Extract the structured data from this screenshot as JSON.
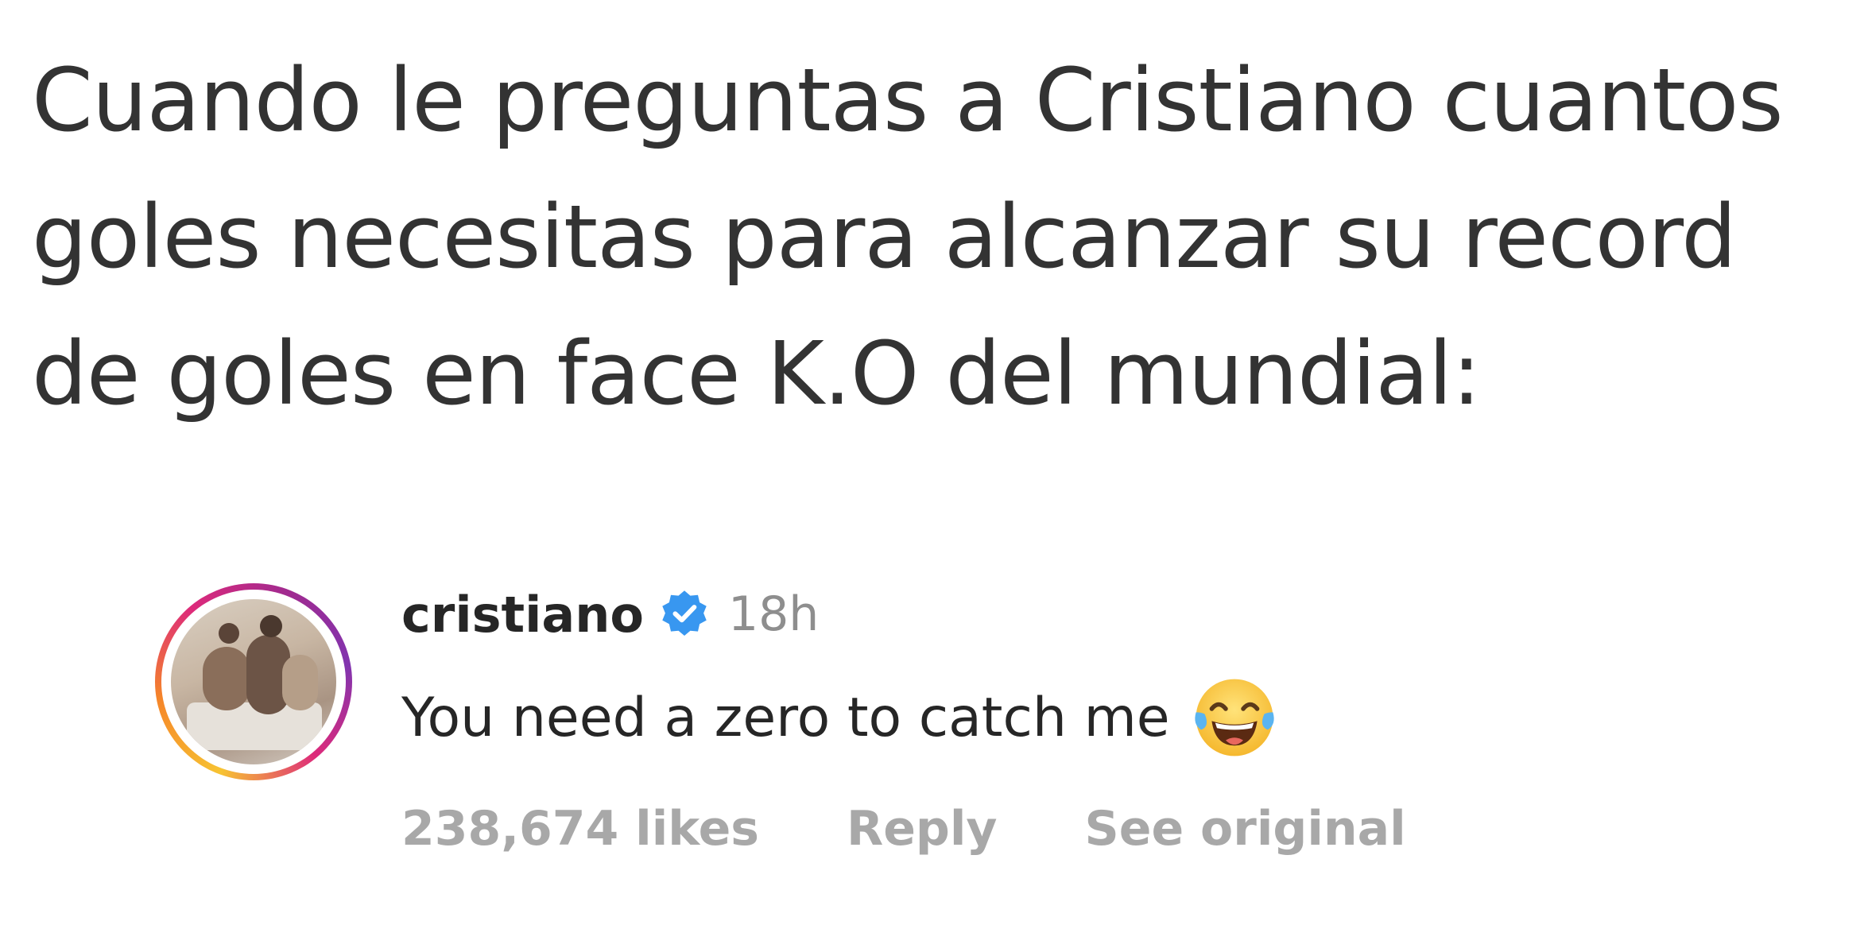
{
  "caption": {
    "lines": [
      "Cuando le preguntas a Cristiano cuantos",
      "goles necesitas para alcanzar su record",
      "de goles en face K.O del mundial:"
    ]
  },
  "comment": {
    "username": "cristiano",
    "verified_icon": "verified-badge-icon",
    "time": "18h",
    "text": "You need a zero to catch me",
    "emoji_icon": "face-with-tears-of-joy-icon",
    "likes": "238,674 likes",
    "reply_label": "Reply",
    "see_original_label": "See original",
    "colors": {
      "verified": "#3897f0",
      "username": "#262626",
      "meta": "#a8a8a8"
    }
  }
}
